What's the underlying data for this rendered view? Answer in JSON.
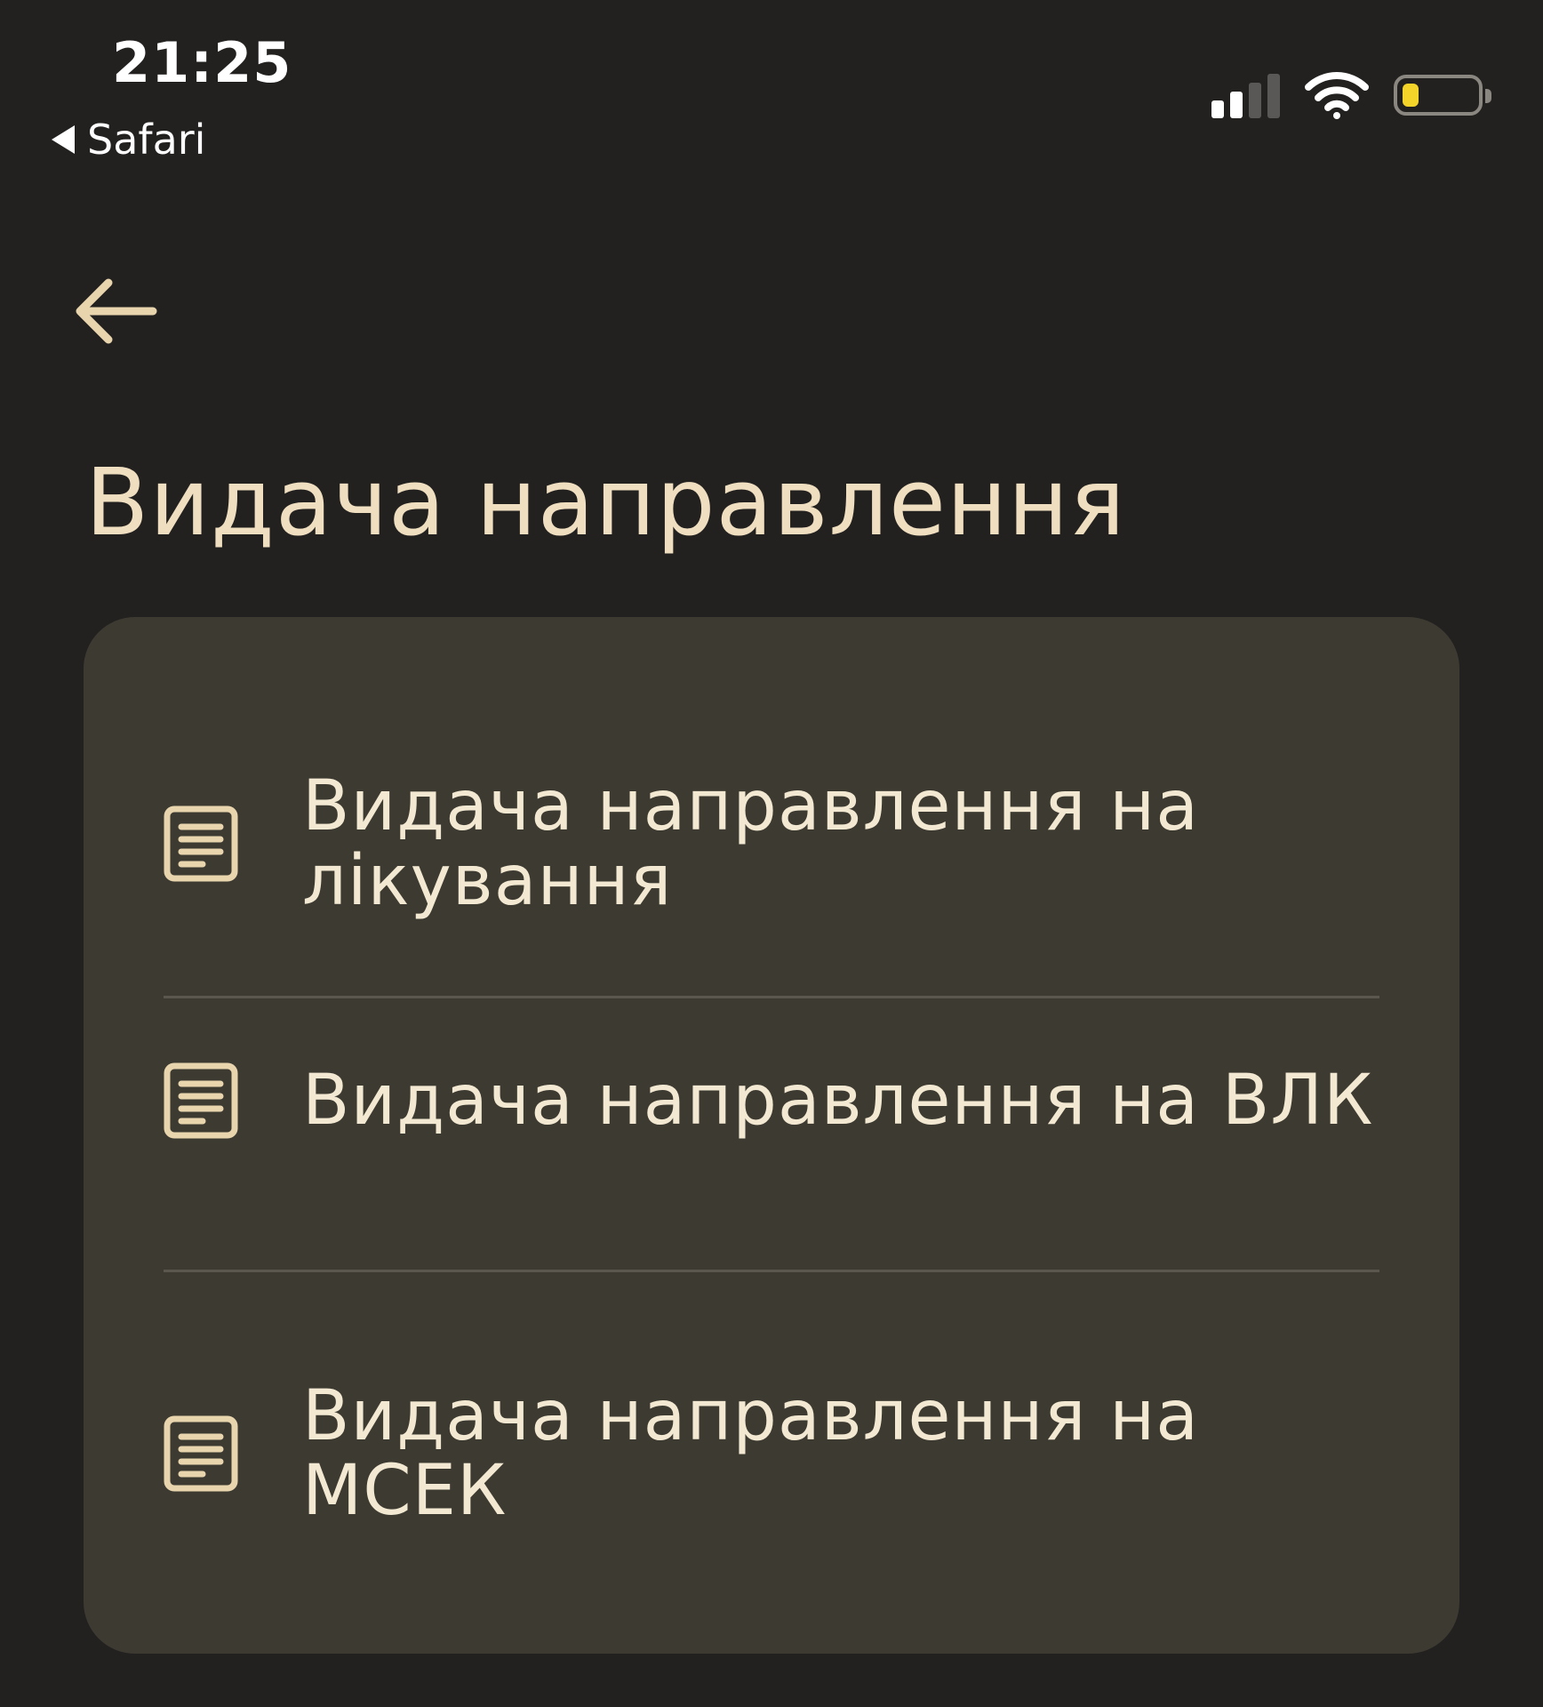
{
  "status_bar": {
    "time": "21:25",
    "back_app": "Safari",
    "battery_level": 0.22,
    "signal_bars": 2,
    "colors": {
      "battery_fill": "#f5d42a"
    }
  },
  "header": {
    "back_icon": "arrow-left-icon",
    "title": "Видача направлення"
  },
  "menu": {
    "items": [
      {
        "label": "Видача направлення на лікування",
        "icon": "document-icon"
      },
      {
        "label": "Видача направлення на ВЛК",
        "icon": "document-icon"
      },
      {
        "label": "Видача направлення на МСЕК",
        "icon": "document-icon"
      }
    ]
  },
  "theme": {
    "background": "#232120",
    "card": "#3d3a32",
    "text": "#f3e9d2",
    "title": "#efdfc0",
    "accent": "#e8d5ad"
  }
}
